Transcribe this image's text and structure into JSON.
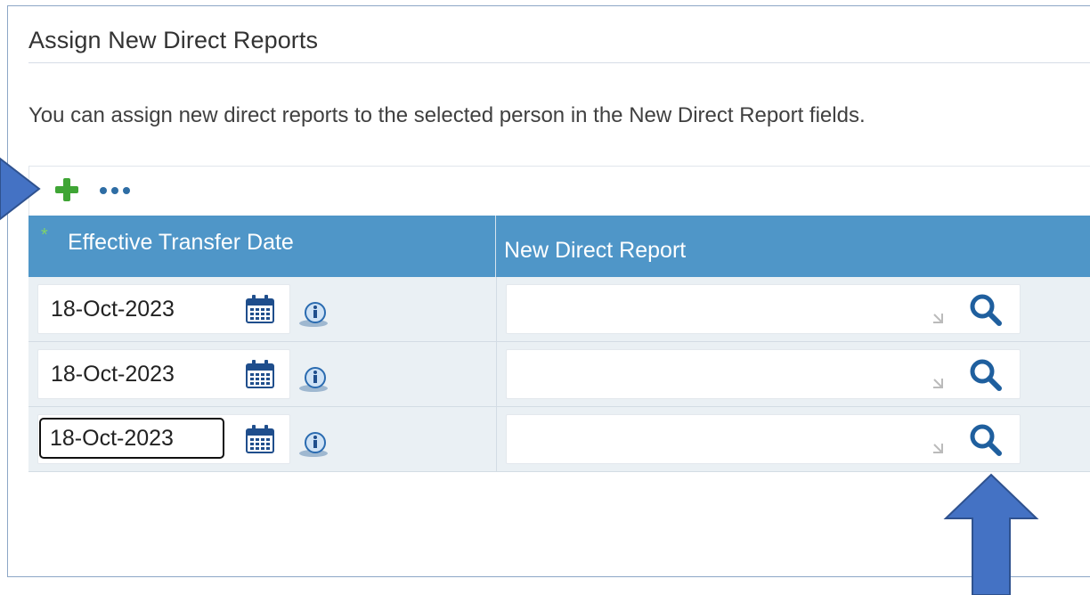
{
  "section": {
    "title": "Assign New Direct Reports",
    "instruction": "You can assign new direct reports to the selected person in the New Direct Report fields."
  },
  "toolbar": {
    "add_icon": "plus-icon",
    "more_icon": "more-options-icon"
  },
  "table": {
    "columns": {
      "effective_date": {
        "label": "Effective Transfer Date",
        "required_marker": "*"
      },
      "new_direct_report": {
        "label": "New Direct Report"
      }
    },
    "rows": [
      {
        "effective_date": "18-Oct-2023",
        "new_direct_report": ""
      },
      {
        "effective_date": "18-Oct-2023",
        "new_direct_report": ""
      },
      {
        "effective_date": "18-Oct-2023",
        "new_direct_report": ""
      }
    ]
  },
  "icons": {
    "calendar": "calendar-icon",
    "info": "info-icon",
    "search": "search-icon",
    "resize": "resize-handle-icon"
  },
  "colors": {
    "header_bg": "#4f96c8",
    "row_bg": "#eaf0f4",
    "icon_blue": "#1f5f9e",
    "add_green": "#3fa535",
    "annotation_arrow": "#4472c4"
  }
}
